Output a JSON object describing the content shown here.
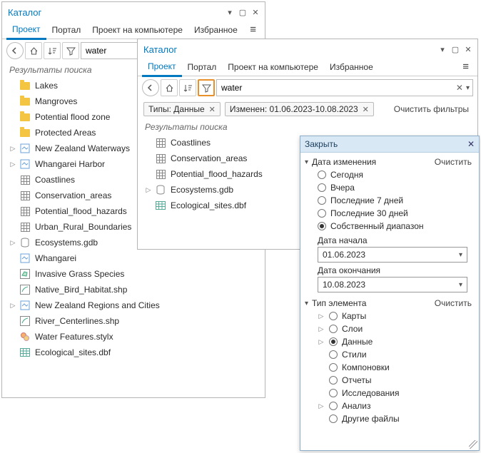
{
  "panel_a": {
    "title": "Каталог",
    "tabs": [
      "Проект",
      "Портал",
      "Проект на компьютере",
      "Избранное"
    ],
    "active_tab": 0,
    "search": {
      "value": "water"
    },
    "results_label": "Результаты поиска",
    "items": [
      {
        "icon": "folder",
        "label": "Lakes"
      },
      {
        "icon": "folder",
        "label": "Mangroves"
      },
      {
        "icon": "folder",
        "label": "Potential flood zone"
      },
      {
        "icon": "folder",
        "label": "Protected Areas"
      },
      {
        "icon": "layer",
        "label": "New Zealand Waterways",
        "expandable": true
      },
      {
        "icon": "layer",
        "label": "Whangarei Harbor",
        "expandable": true
      },
      {
        "icon": "grid",
        "label": "Coastlines"
      },
      {
        "icon": "grid",
        "label": "Conservation_areas"
      },
      {
        "icon": "grid",
        "label": "Potential_flood_hazards"
      },
      {
        "icon": "grid",
        "label": "Urban_Rural_Boundaries"
      },
      {
        "icon": "db",
        "label": "Ecosystems.gdb",
        "expandable": true
      },
      {
        "icon": "layer",
        "label": "Whangarei"
      },
      {
        "icon": "shp-g",
        "label": "Invasive Grass Species"
      },
      {
        "icon": "shp",
        "label": "Native_Bird_Habitat.shp"
      },
      {
        "icon": "layer",
        "label": "New Zealand Regions and Cities",
        "expandable": true
      },
      {
        "icon": "shp",
        "label": "River_Centerlines.shp"
      },
      {
        "icon": "stylx",
        "label": "Water Features.stylx"
      },
      {
        "icon": "table",
        "label": "Ecological_sites.dbf"
      }
    ]
  },
  "panel_b": {
    "title": "Каталог",
    "tabs": [
      "Проект",
      "Портал",
      "Проект на компьютере",
      "Избранное"
    ],
    "active_tab": 0,
    "search": {
      "value": "water"
    },
    "chips": [
      {
        "label": "Типы: Данные"
      },
      {
        "label": "Изменен: 01.06.2023-10.08.2023"
      }
    ],
    "clear_filters": "Очистить фильтры",
    "results_label": "Результаты поиска",
    "items": [
      {
        "icon": "grid",
        "label": "Coastlines"
      },
      {
        "icon": "grid",
        "label": "Conservation_areas"
      },
      {
        "icon": "grid",
        "label": "Potential_flood_hazards"
      },
      {
        "icon": "db",
        "label": "Ecosystems.gdb",
        "expandable": true
      },
      {
        "icon": "table",
        "label": "Ecological_sites.dbf"
      }
    ]
  },
  "filter_popup": {
    "header": "Закрыть",
    "date_group": {
      "title": "Дата изменения",
      "clear": "Очистить",
      "options": [
        {
          "label": "Сегодня",
          "selected": false
        },
        {
          "label": "Вчера",
          "selected": false
        },
        {
          "label": "Последние 7 дней",
          "selected": false
        },
        {
          "label": "Последние 30 дней",
          "selected": false
        },
        {
          "label": "Собственный диапазон",
          "selected": true
        }
      ],
      "start_label": "Дата начала",
      "start_value": "01.06.2023",
      "end_label": "Дата окончания",
      "end_value": "10.08.2023"
    },
    "type_group": {
      "title": "Тип элемента",
      "clear": "Очистить",
      "options": [
        {
          "label": "Карты",
          "selected": false,
          "expandable": true
        },
        {
          "label": "Слои",
          "selected": false,
          "expandable": true
        },
        {
          "label": "Данные",
          "selected": true,
          "expandable": true
        },
        {
          "label": "Стили",
          "selected": false,
          "expandable": false
        },
        {
          "label": "Компоновки",
          "selected": false,
          "expandable": false
        },
        {
          "label": "Отчеты",
          "selected": false,
          "expandable": false
        },
        {
          "label": "Исследования",
          "selected": false,
          "expandable": false
        },
        {
          "label": "Анализ",
          "selected": false,
          "expandable": true
        },
        {
          "label": "Другие файлы",
          "selected": false,
          "expandable": false
        }
      ]
    }
  }
}
